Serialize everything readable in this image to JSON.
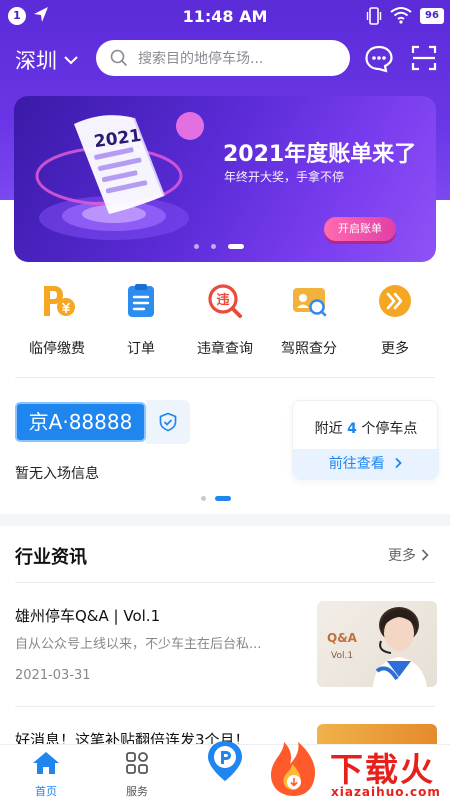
{
  "status_bar": {
    "notification_count": "1",
    "time": "11:48 AM",
    "battery": "96"
  },
  "header": {
    "city": "深圳",
    "search_placeholder": "搜索目的地停车场..."
  },
  "banner": {
    "badge_year": "2021",
    "title": "2021年度账单来了",
    "subtitle": "年终开大奖，手拿不停",
    "button_label": "开启账单",
    "page_count": 3,
    "active_page": 3
  },
  "actions": [
    {
      "label": "临停缴费",
      "icon": "parking-payment-icon"
    },
    {
      "label": "订单",
      "icon": "order-clipboard-icon"
    },
    {
      "label": "违章查询",
      "icon": "violation-search-icon"
    },
    {
      "label": "驾照查分",
      "icon": "license-check-icon"
    },
    {
      "label": "更多",
      "icon": "more-arrows-icon"
    }
  ],
  "vehicle": {
    "plate": "京A·88888",
    "entry_status": "暂无入场信息"
  },
  "nearby": {
    "prefix": "附近",
    "count": "4",
    "suffix": "个停车点",
    "button": "前往查看"
  },
  "news": {
    "title": "行业资讯",
    "more": "更多",
    "articles": [
      {
        "title": "雄州停车Q&A | Vol.1",
        "desc": "自从公众号上线以来，不少车主在后台私...",
        "date": "2021-03-31",
        "thumb_badge": "Q&A",
        "thumb_vol": "Vol.1"
      },
      {
        "title": "好消息！这笔补贴翻倍连发3个月！"
      }
    ]
  },
  "bottom_nav": {
    "home": "首页",
    "service": "服务"
  },
  "watermark": {
    "text": "下载火",
    "domain": "xiazaihuo.com"
  },
  "colors": {
    "brand_purple": "#5b2bd8",
    "accent_blue": "#1f86f0"
  }
}
